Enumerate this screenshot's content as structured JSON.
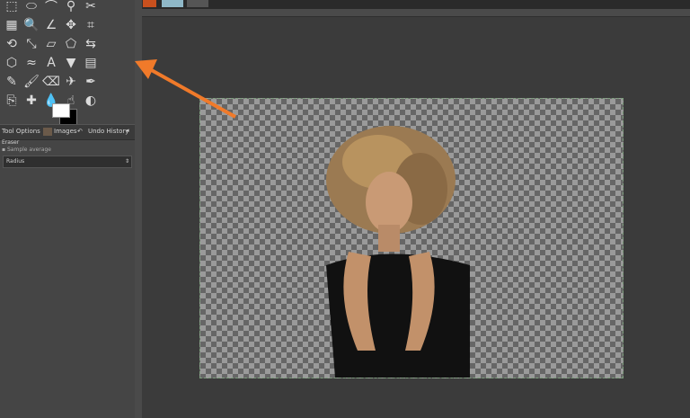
{
  "toolbox": {
    "tools": [
      {
        "name": "rect-select-icon",
        "glyph": "⬚"
      },
      {
        "name": "ellipse-select-icon",
        "glyph": "⬭"
      },
      {
        "name": "free-select-icon",
        "glyph": "⌒"
      },
      {
        "name": "fuzzy-select-icon",
        "glyph": "⚲"
      },
      {
        "name": "scissors-icon",
        "glyph": "✂"
      },
      {
        "name": "select-by-color-icon",
        "glyph": "▦"
      },
      {
        "name": "zoom-icon",
        "glyph": "🔍"
      },
      {
        "name": "measure-icon",
        "glyph": "∠"
      },
      {
        "name": "move-icon",
        "glyph": "✥"
      },
      {
        "name": "crop-icon",
        "glyph": "⌗"
      },
      {
        "name": "rotate-icon",
        "glyph": "⟲"
      },
      {
        "name": "scale-icon",
        "glyph": "⤡"
      },
      {
        "name": "shear-icon",
        "glyph": "▱"
      },
      {
        "name": "perspective-icon",
        "glyph": "⬠"
      },
      {
        "name": "flip-icon",
        "glyph": "⇆"
      },
      {
        "name": "cage-icon",
        "glyph": "⬡"
      },
      {
        "name": "warp-icon",
        "glyph": "≈"
      },
      {
        "name": "text-icon",
        "glyph": "A"
      },
      {
        "name": "bucket-fill-icon",
        "glyph": "▼"
      },
      {
        "name": "gradient-icon",
        "glyph": "▤"
      },
      {
        "name": "pencil-icon",
        "glyph": "✎"
      },
      {
        "name": "paintbrush-icon",
        "glyph": "🖌"
      },
      {
        "name": "eraser-icon",
        "glyph": "⌫"
      },
      {
        "name": "airbrush-icon",
        "glyph": "✈"
      },
      {
        "name": "ink-icon",
        "glyph": "✒"
      },
      {
        "name": "clone-icon",
        "glyph": "⎘"
      },
      {
        "name": "heal-icon",
        "glyph": "✚"
      },
      {
        "name": "blur-icon",
        "glyph": "💧"
      },
      {
        "name": "smudge-icon",
        "glyph": "☝"
      },
      {
        "name": "dodge-burn-icon",
        "glyph": "◐"
      }
    ]
  },
  "tabs": {
    "tool_options": "Tool Options",
    "images": "Images",
    "undo_history": "Undo History"
  },
  "tool_options": {
    "title": "Eraser",
    "sample_average": "Sample average",
    "radius_label": "Radius"
  },
  "canvas": {
    "annotation_color": "#f07a2a"
  }
}
